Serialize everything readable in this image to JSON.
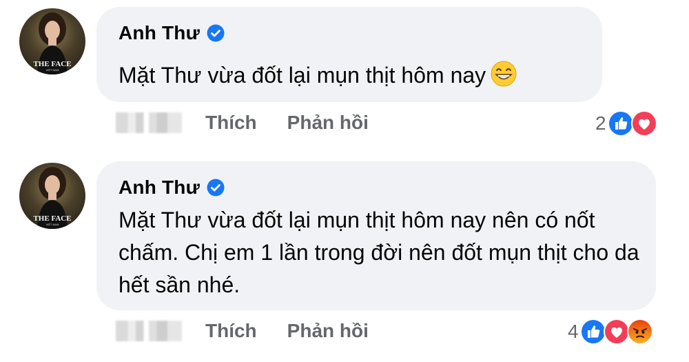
{
  "comments": [
    {
      "author": "Anh Thư",
      "avatar_brand": "THE FACE",
      "avatar_sub": "VIỆT NAM",
      "text": "Mặt Thư vừa đốt lại mụn thịt hôm nay",
      "like_label": "Thích",
      "reply_label": "Phản hồi",
      "reaction_count": "2",
      "reactions": [
        "like-icon",
        "love-icon"
      ]
    },
    {
      "author": "Anh Thư",
      "avatar_brand": "THE FACE",
      "avatar_sub": "VIỆT NAM",
      "text": "Mặt Thư vừa đốt lại mụn thịt hôm nay nên có nốt chấm. Chị em 1 lần trong đời nên đốt mụn thịt cho da hết sần nhé.",
      "like_label": "Thích",
      "reply_label": "Phản hồi",
      "reaction_count": "4",
      "reactions": [
        "like-icon",
        "love-icon",
        "angry-icon"
      ]
    }
  ],
  "colors": {
    "bubble": "#f0f2f5",
    "secondary_text": "#65676b",
    "verified_blue": "#1877f2",
    "like_blue": "#1877f2",
    "love_red": "#f33e58",
    "angry_orange": "#e9710f"
  }
}
